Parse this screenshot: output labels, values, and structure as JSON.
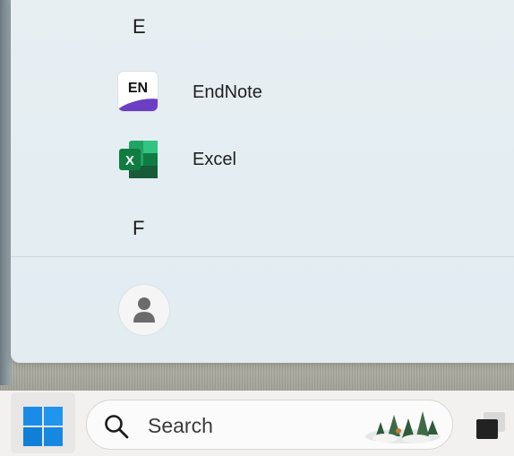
{
  "start_menu": {
    "sections": [
      {
        "letter": "E"
      },
      {
        "letter": "F"
      }
    ],
    "apps": [
      {
        "name": "EndNote",
        "icon_label": "EN",
        "icon": "endnote-icon"
      },
      {
        "name": "Excel",
        "icon_label": "X",
        "icon": "excel-icon"
      }
    ],
    "user": {
      "icon": "person-icon"
    }
  },
  "taskbar": {
    "start_icon": "windows-logo-icon",
    "search": {
      "label": "Search",
      "icon": "search-icon",
      "highlight_icon": "forest-highlight-icon"
    },
    "task_view_icon": "task-view-icon"
  },
  "colors": {
    "windows_blue": "#1a8ce8",
    "excel_green": "#107c41",
    "endnote_purple": "#6a3fc4"
  }
}
